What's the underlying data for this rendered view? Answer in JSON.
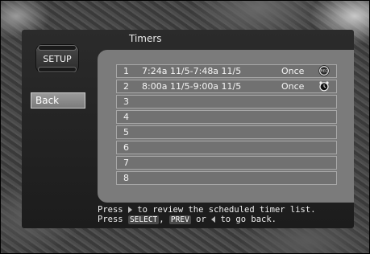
{
  "screen": {
    "title": "Timers"
  },
  "sidebar": {
    "setup_label": "SETUP",
    "back_label": "Back"
  },
  "timers": [
    {
      "num": "1",
      "time": "7:24a 11/5-7:48a 11/5",
      "freq": "Once",
      "icon": "rec-icon"
    },
    {
      "num": "2",
      "time": "8:00a 11/5-9:00a 11/5",
      "freq": "Once",
      "icon": "alarm-clock-icon"
    },
    {
      "num": "3",
      "time": "",
      "freq": "",
      "icon": ""
    },
    {
      "num": "4",
      "time": "",
      "freq": "",
      "icon": ""
    },
    {
      "num": "5",
      "time": "",
      "freq": "",
      "icon": ""
    },
    {
      "num": "6",
      "time": "",
      "freq": "",
      "icon": ""
    },
    {
      "num": "7",
      "time": "",
      "freq": "",
      "icon": ""
    },
    {
      "num": "8",
      "time": "",
      "freq": "",
      "icon": ""
    }
  ],
  "help": {
    "line1_a": "Press",
    "line1_b": "to review the scheduled timer list.",
    "line2_a": "Press",
    "key_select": "SELECT",
    "comma": ",",
    "key_prev": "PREV",
    "or": "or",
    "line2_b": "to go back."
  },
  "icons": {
    "rec_label": "REC"
  }
}
